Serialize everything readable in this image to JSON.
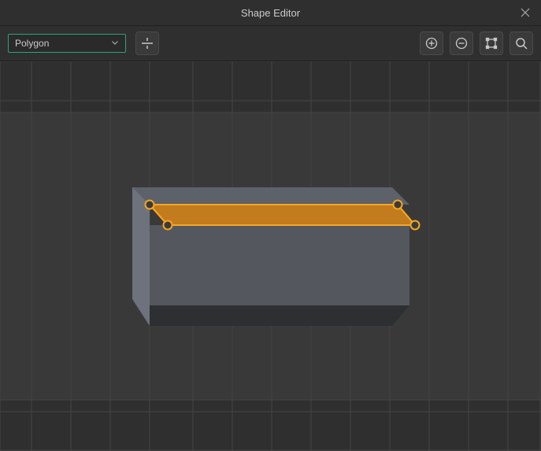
{
  "window": {
    "title": "Shape Editor"
  },
  "toolbar": {
    "mode": "Polygon",
    "icons": {
      "snap": "snap-to-grid",
      "zoom_in": "zoom-in",
      "zoom_out": "zoom-out",
      "fit": "fit-view",
      "search": "search"
    }
  },
  "viewport": {
    "grid": true,
    "selection": "polygon-face",
    "object": "box",
    "colors": {
      "selection_fill": "#c27b1d",
      "selection_stroke": "#f5a623",
      "vertex_fill": "#3a3a3a",
      "vertex_stroke": "#f5a623"
    }
  }
}
